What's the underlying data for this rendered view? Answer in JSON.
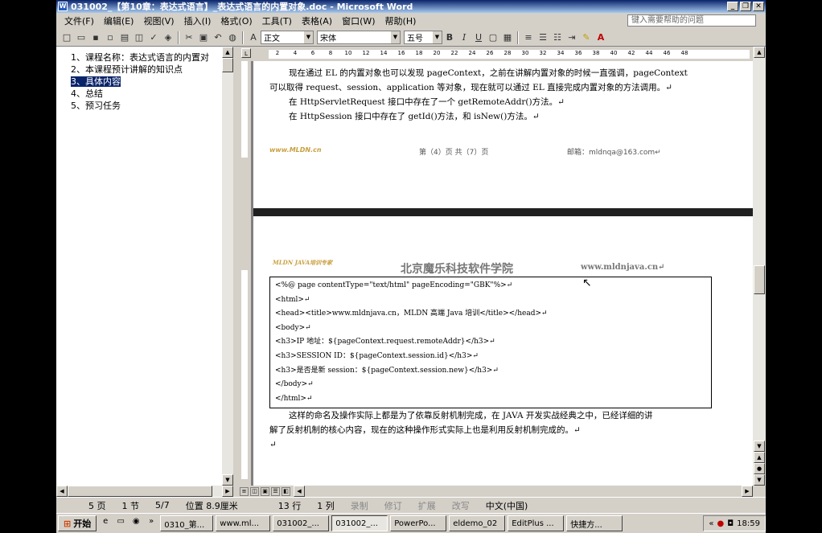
{
  "window": {
    "title": "031002_【第10章：表达式语言】_表达式语言的内置对象.doc - Microsoft Word"
  },
  "menu": {
    "items": [
      "文件(F)",
      "编辑(E)",
      "视图(V)",
      "插入(I)",
      "格式(O)",
      "工具(T)",
      "表格(A)",
      "窗口(W)",
      "帮助(H)"
    ],
    "help_placeholder": "键入需要帮助的问题"
  },
  "toolbar": {
    "style": "正文",
    "font": "宋体",
    "size": "五号",
    "bold": "B",
    "italic": "I",
    "underline": "U"
  },
  "outline": {
    "items": [
      "1、课程名称：表达式语言的内置对",
      "2、本课程预计讲解的知识点",
      "3、具体内容",
      "4、总结",
      "5、预习任务"
    ],
    "selected_index": 2
  },
  "ruler": {
    "ticks": [
      "2",
      "4",
      "6",
      "8",
      "10",
      "12",
      "14",
      "16",
      "18",
      "20",
      "22",
      "24",
      "26",
      "28",
      "30",
      "32",
      "34",
      "36",
      "38",
      "40",
      "42",
      "44",
      "46",
      "48"
    ]
  },
  "page1": {
    "lines": [
      "现在通过 EL 的内置对象也可以发现 pageContext，之前在讲解内置对象的时候一直强调，pageContext",
      "可以取得 request、session、application 等对象，现在就可以通过 EL 直接完成内置对象的方法调用。↵",
      "在 HttpServletRequest 接口中存在了一个 getRemoteAddr()方法。↵",
      "在 HttpSession 接口中存在了 getId()方法，和 isNew()方法。↵"
    ],
    "logo": "www.MLDN.cn",
    "footer_page": "第（4）页  共（7）页",
    "footer_email": "邮箱：mldnqa@163.com↵"
  },
  "page2": {
    "logo": "MLDN JAVA培训专家",
    "header_title": "北京魔乐科技软件学院",
    "header_url": "www.mldnjava.cn↵",
    "code": [
      "<%@ page contentType=\"text/html\" pageEncoding=\"GBK\"%>↵",
      "<html>↵",
      "<head><title>www.mldnjava.cn，MLDN 高端 Java 培训</title></head>↵",
      "<body>↵",
      "<h3>IP 地址：${pageContext.request.remoteAddr}</h3>↵",
      "<h3>SESSION ID：${pageContext.session.id}</h3>↵",
      "<h3>是否是新 session：${pageContext.session.new}</h3>↵",
      "</body>↵",
      "</html>↵"
    ],
    "after": [
      "这样的命名及操作实际上都是为了依靠反射机制完成，在 JAVA 开发实战经典之中，已经详细的讲",
      "解了反射机制的核心内容，现在的这种操作形式实际上也是利用反射机制完成的。↵",
      "↵"
    ]
  },
  "status": {
    "page": "5 页",
    "section": "1 节",
    "page_of": "5/7",
    "position": "位置 8.9厘米",
    "line": "13 行",
    "col": "1 列",
    "rec": "录制",
    "trk": "修订",
    "ext": "扩展",
    "ovr": "改写",
    "lang": "中文(中国)"
  },
  "taskbar": {
    "start": "开始",
    "tasks": [
      "0310_第...",
      "www.ml...",
      "031002_...",
      "031002_...",
      "PowerPo...",
      "eldemo_02",
      "EditPlus ...",
      "快捷方..."
    ],
    "active_index": 3,
    "clock": "18:59"
  },
  "colors": {
    "selection": "#0a246a",
    "titlebar": "#0a246a",
    "chrome": "#d4d0c8"
  }
}
